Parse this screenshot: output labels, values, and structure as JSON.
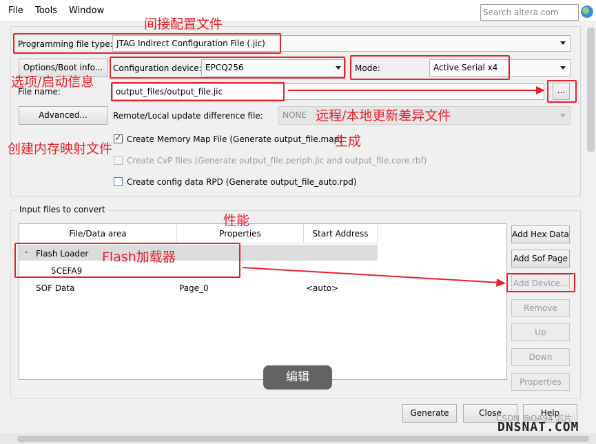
{
  "menu": {
    "file": "File",
    "tools": "Tools",
    "window": "Window"
  },
  "search": {
    "placeholder": "Search altera.com"
  },
  "output": {
    "programming_file_type_label": "Programming file type:",
    "programming_file_type_value": "JTAG Indirect Configuration File (.jic)",
    "options_boot_button": "Options/Boot info...",
    "configuration_device_label": "Configuration device:",
    "configuration_device_value": "EPCQ256",
    "mode_label": "Mode:",
    "mode_value": "Active Serial x4",
    "file_name_label": "File name:",
    "file_name_value": "output_files/output_file.jic",
    "browse_button": "...",
    "advanced_button": "Advanced...",
    "remote_local_label": "Remote/Local update difference file:",
    "remote_local_value": "NONE",
    "create_memory_map": "Create Memory Map File (Generate output_file.map)",
    "create_cvp": "Create CvP files (Generate output_file.periph.jic and output_file.core.rbf)",
    "create_config_rpd": "Create config data RPD (Generate output_file_auto.rpd)"
  },
  "input": {
    "group_label": "Input files to convert",
    "columns": [
      "File/Data area",
      "Properties",
      "Start Address"
    ],
    "rows": [
      {
        "name": "Flash Loader",
        "properties": "",
        "address": ""
      },
      {
        "name": "5CEFA9",
        "properties": "",
        "address": ""
      },
      {
        "name": "SOF Data",
        "properties": "Page_0",
        "address": "<auto>"
      }
    ]
  },
  "side_buttons": {
    "add_hex": "Add Hex Data",
    "add_sof": "Add Sof Page",
    "add_device": "Add Device...",
    "remove": "Remove",
    "up": "Up",
    "down": "Down",
    "properties": "Properties"
  },
  "bottom_buttons": {
    "generate": "Generate",
    "close": "Close",
    "help": "Help"
  },
  "annotations": {
    "indirect_config_file": "间接配置文件",
    "options_boot_info": "选项/启动信息",
    "remote_local_diff": "远程/本地更新差异文件",
    "create_memory_map": "创建内存映射文件",
    "generate": "生成",
    "properties": "性能",
    "flash_loader": "Flash加载器",
    "edit": "编辑"
  },
  "watermark": {
    "csdn": "CSDN @OA94 芯片",
    "site": "DNSNAT.COM"
  },
  "colors": {
    "annotation_red": "#e8202a",
    "window_bg": "#f0f0f0",
    "edit_pill": "#636363"
  }
}
